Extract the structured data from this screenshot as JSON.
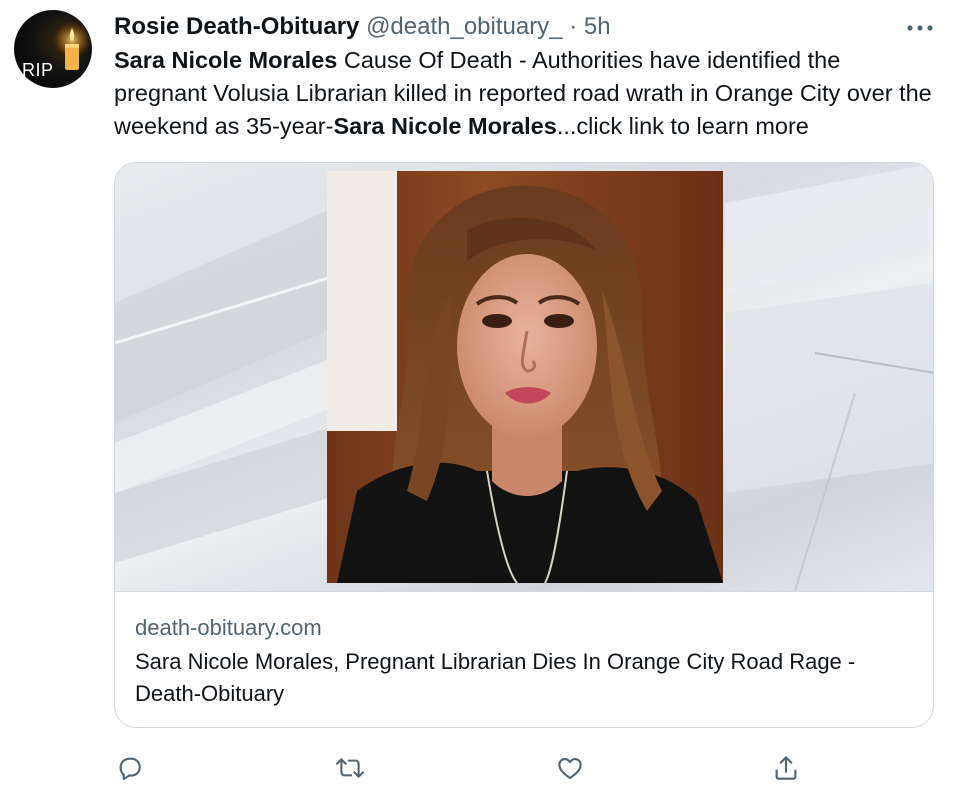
{
  "avatar": {
    "text": "RIP"
  },
  "header": {
    "display_name": "Rosie Death-Obituary",
    "handle": "@death_obituary_",
    "separator": "·",
    "time": "5h",
    "more_icon": "more-horizontal-icon"
  },
  "tweet": {
    "name_bold_1": "Sara Nicole Morales",
    "text_1": " Cause Of Death - Authorities have identified the pregnant Volusia Librarian killed in reported road wrath in Orange City over the weekend as 35-year-",
    "name_bold_2": "Sara Nicole Morales",
    "text_2": "...click link to learn more"
  },
  "card": {
    "domain": "death-obituary.com",
    "title": "Sara Nicole Morales, Pregnant Librarian Dies In Orange City Road Rage - Death-Obituary"
  },
  "actions": [
    {
      "name": "reply",
      "icon": "reply-icon"
    },
    {
      "name": "retweet",
      "icon": "retweet-icon"
    },
    {
      "name": "like",
      "icon": "heart-icon"
    },
    {
      "name": "share",
      "icon": "share-icon"
    }
  ],
  "colors": {
    "text_primary": "#0f1419",
    "text_secondary": "#536471",
    "border": "#cfd9de"
  }
}
